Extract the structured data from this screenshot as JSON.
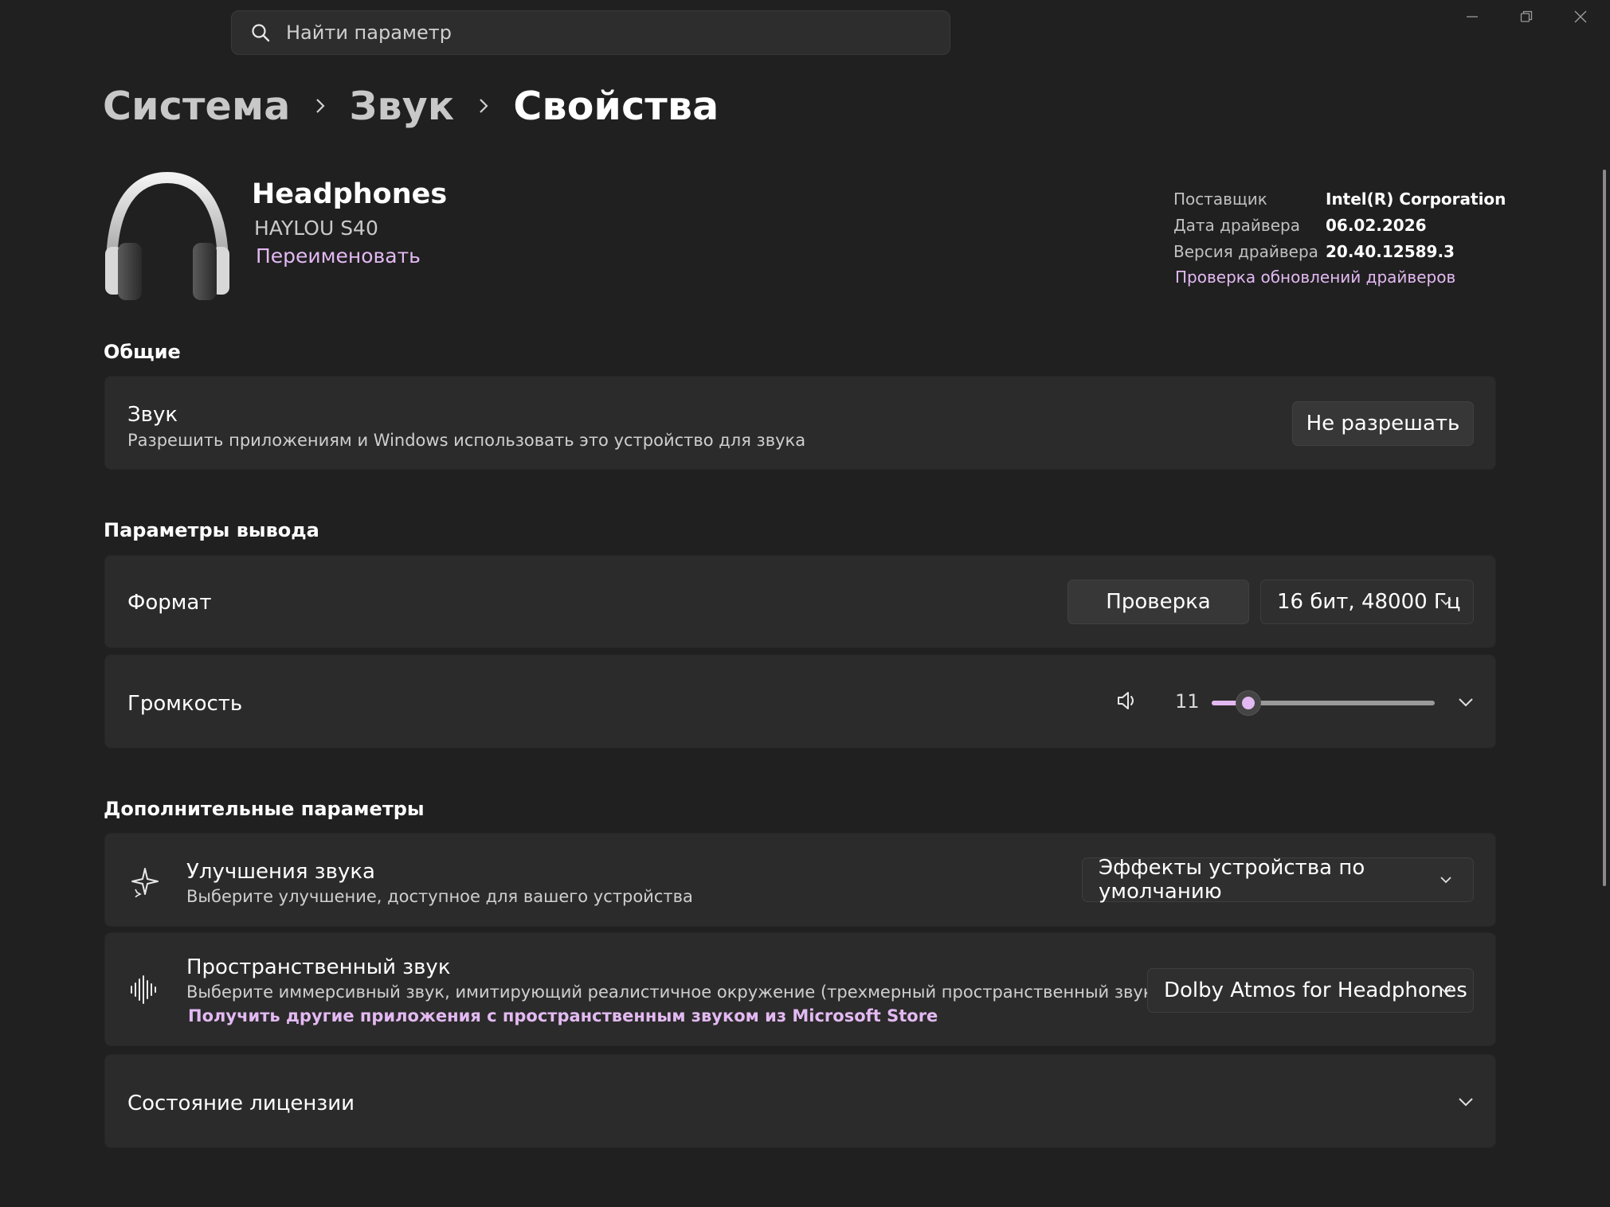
{
  "search": {
    "placeholder": "Найти параметр"
  },
  "window_controls": {
    "minimize": "minimize-icon",
    "maximize": "restore-icon",
    "close": "close-icon"
  },
  "breadcrumb": {
    "items": [
      "Система",
      "Звук",
      "Свойства"
    ]
  },
  "device": {
    "name": "Headphones",
    "model": "HAYLOU S40",
    "rename_label": "Переименовать",
    "icon": "headphones-icon"
  },
  "driver": {
    "rows": [
      {
        "label": "Поставщик",
        "value": "Intel(R) Corporation"
      },
      {
        "label": "Дата драйвера",
        "value": "06.02.2026"
      },
      {
        "label": "Версия драйвера",
        "value": "20.40.12589.3"
      }
    ],
    "update_link": "Проверка обновлений драйверов"
  },
  "general": {
    "title": "Общие",
    "sound": {
      "title": "Звук",
      "description": "Разрешить приложениям и Windows использовать это устройство для звука",
      "button": "Не разрешать"
    }
  },
  "output": {
    "title": "Параметры вывода",
    "format": {
      "title": "Формат",
      "test_button": "Проверка",
      "selected": "16 бит, 48000 Гц"
    },
    "volume": {
      "title": "Громкость",
      "value": "11",
      "level": 0.11,
      "icon": "speaker-icon"
    }
  },
  "advanced": {
    "title": "Дополнительные параметры",
    "enhancements": {
      "title": "Улучшения звука",
      "description": "Выберите улучшение, доступное для вашего устройства",
      "selected": "Эффекты устройства по умолчанию",
      "icon": "sparkle-icon"
    },
    "spatial": {
      "title": "Пространственный звук",
      "description": "Выберите иммерсивный звук, имитирующий реалистичное окружение (трехмерный пространственный звук)",
      "store_link": "Получить другие приложения с пространственным звуком из Microsoft Store",
      "selected": "Dolby Atmos for Headphones",
      "icon": "sound-wave-icon"
    },
    "license": {
      "title": "Состояние лицензии"
    }
  },
  "colors": {
    "accent": "#e3b9f2",
    "background": "#202020",
    "card": "#2b2b2b"
  }
}
